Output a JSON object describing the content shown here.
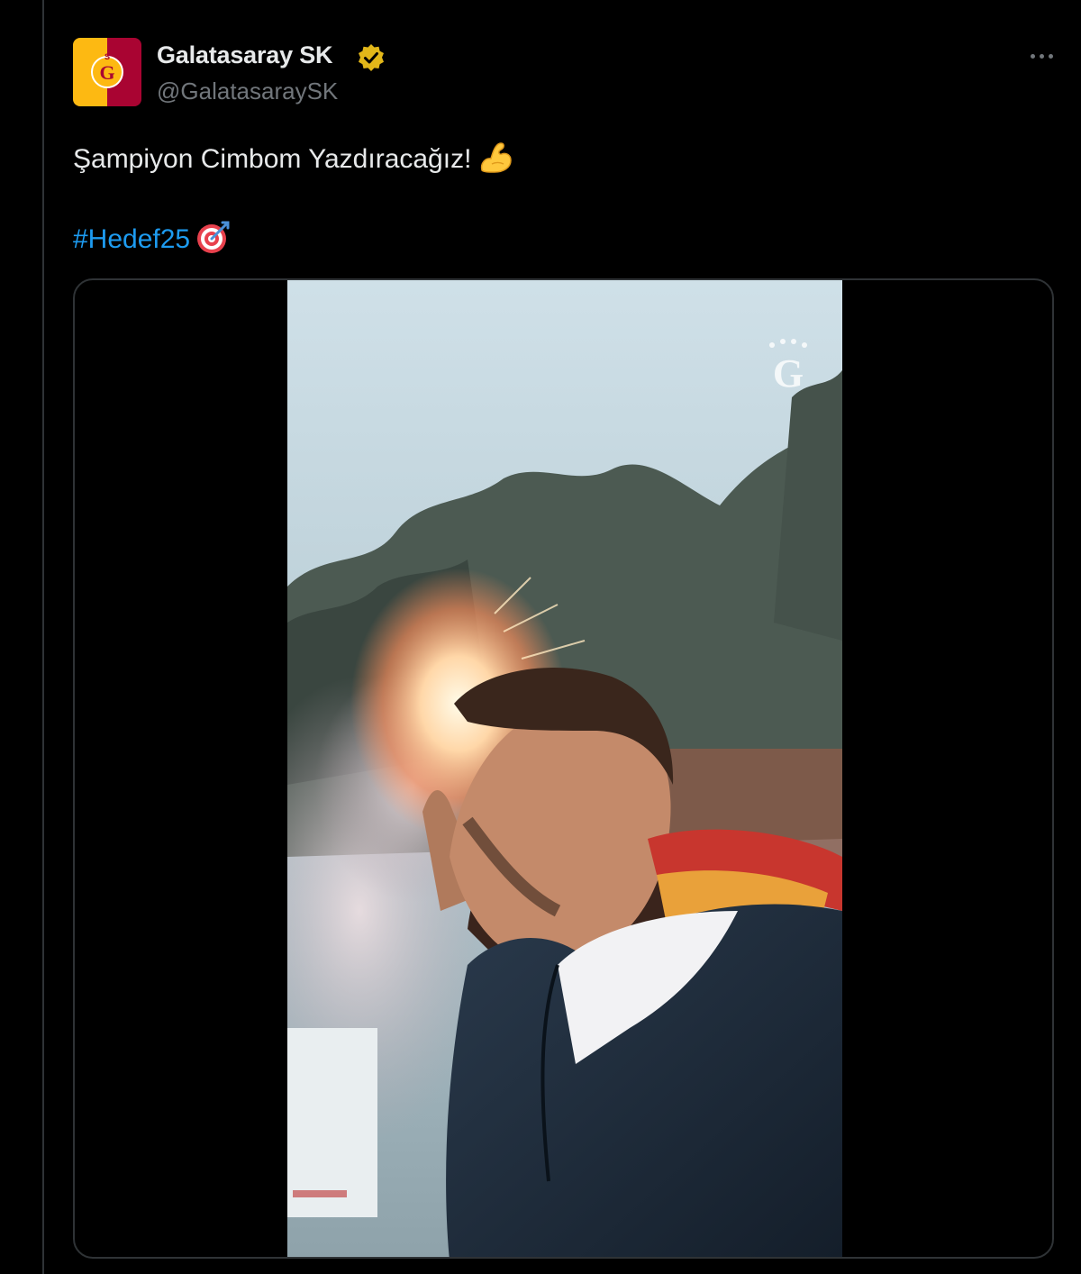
{
  "tweet": {
    "author": {
      "display_name": "Galatasaray SK",
      "handle": "@GalatasaraySK",
      "verified_badge": "gold-verified-icon",
      "avatar_icon": "galatasaray-crest-icon"
    },
    "more_icon": "more-dots-icon",
    "text": "Şampiyon Cimbom Yazdıracağız!",
    "text_emoji": "flexed-biceps-icon",
    "hashtag": "#Hedef25",
    "hashtag_emoji": "direct-hit-target-icon",
    "media": {
      "type": "video",
      "watermark_icon": "galatasaray-crest-watermark-icon",
      "scene": "fan-with-flare-icon"
    }
  },
  "colors": {
    "background": "#000000",
    "primary_text": "#e7e9ea",
    "secondary_text": "#71767b",
    "link": "#1d9bf0",
    "border": "#2f3336",
    "brand_yellow": "#fdb912",
    "brand_red": "#a90432",
    "verified_gold": "#e2b719"
  }
}
